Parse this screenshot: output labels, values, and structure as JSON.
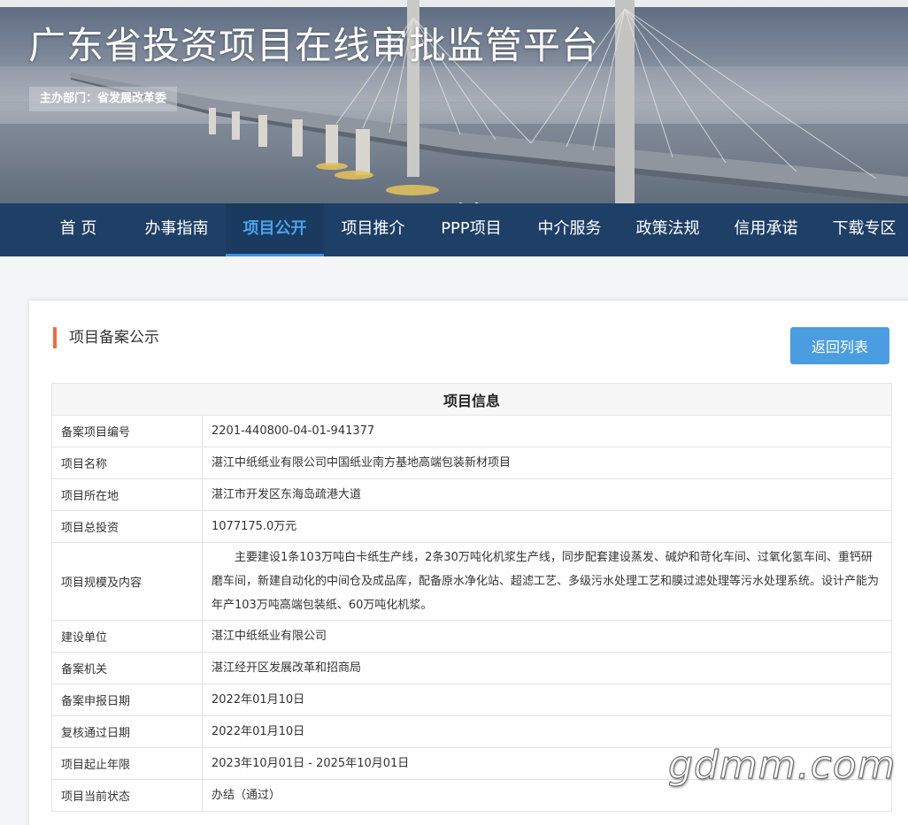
{
  "header": {
    "site_title": "广东省投资项目在线审批监管平台",
    "host": "主办部门：省发展改革委"
  },
  "nav": {
    "items": [
      {
        "label": "首 页",
        "active": false
      },
      {
        "label": "办事指南",
        "active": false
      },
      {
        "label": "项目公开",
        "active": true
      },
      {
        "label": "项目推介",
        "active": false
      },
      {
        "label": "PPP项目",
        "active": false
      },
      {
        "label": "中介服务",
        "active": false
      },
      {
        "label": "政策法规",
        "active": false
      },
      {
        "label": "信用承诺",
        "active": false
      },
      {
        "label": "下载专区",
        "active": false
      }
    ]
  },
  "main": {
    "section_title": "项目备案公示",
    "back_button": "返回列表",
    "table_title": "项目信息",
    "rows": [
      {
        "label": "备案项目编号",
        "value": "2201-440800-04-01-941377"
      },
      {
        "label": "项目名称",
        "value": "湛江中纸纸业有限公司中国纸业南方基地高端包装新材项目"
      },
      {
        "label": "项目所在地",
        "value": "湛江市开发区东海岛疏港大道"
      },
      {
        "label": "项目总投资",
        "value": "1077175.0万元"
      },
      {
        "label": "项目规模及内容",
        "value": "主要建设1条103万吨白卡纸生产线，2条30万吨化机浆生产线，同步配套建设蒸发、碱炉和苛化车间、过氧化氢车间、重钙研磨车间，新建自动化的中间仓及成品库，配备原水净化站、超滤工艺、多级污水处理工艺和膜过滤处理等污水处理系统。设计产能为年产103万吨高端包装纸、60万吨化机浆。"
      },
      {
        "label": "建设单位",
        "value": "湛江中纸纸业有限公司"
      },
      {
        "label": "备案机关",
        "value": "湛江经开区发展改革和招商局"
      },
      {
        "label": "备案申报日期",
        "value": "2022年01月10日"
      },
      {
        "label": "复核通过日期",
        "value": "2022年01月10日"
      },
      {
        "label": "项目起止年限",
        "value": "2023年10月01日 - 2025年10月01日"
      },
      {
        "label": "项目当前状态",
        "value": "办结（通过）"
      }
    ]
  },
  "watermark": "gdmm.com",
  "colors": {
    "nav_bg": "#1e3f66",
    "nav_active": "#4aa3e8",
    "accent_bar": "#f26a3b",
    "button": "#4a9de0"
  }
}
